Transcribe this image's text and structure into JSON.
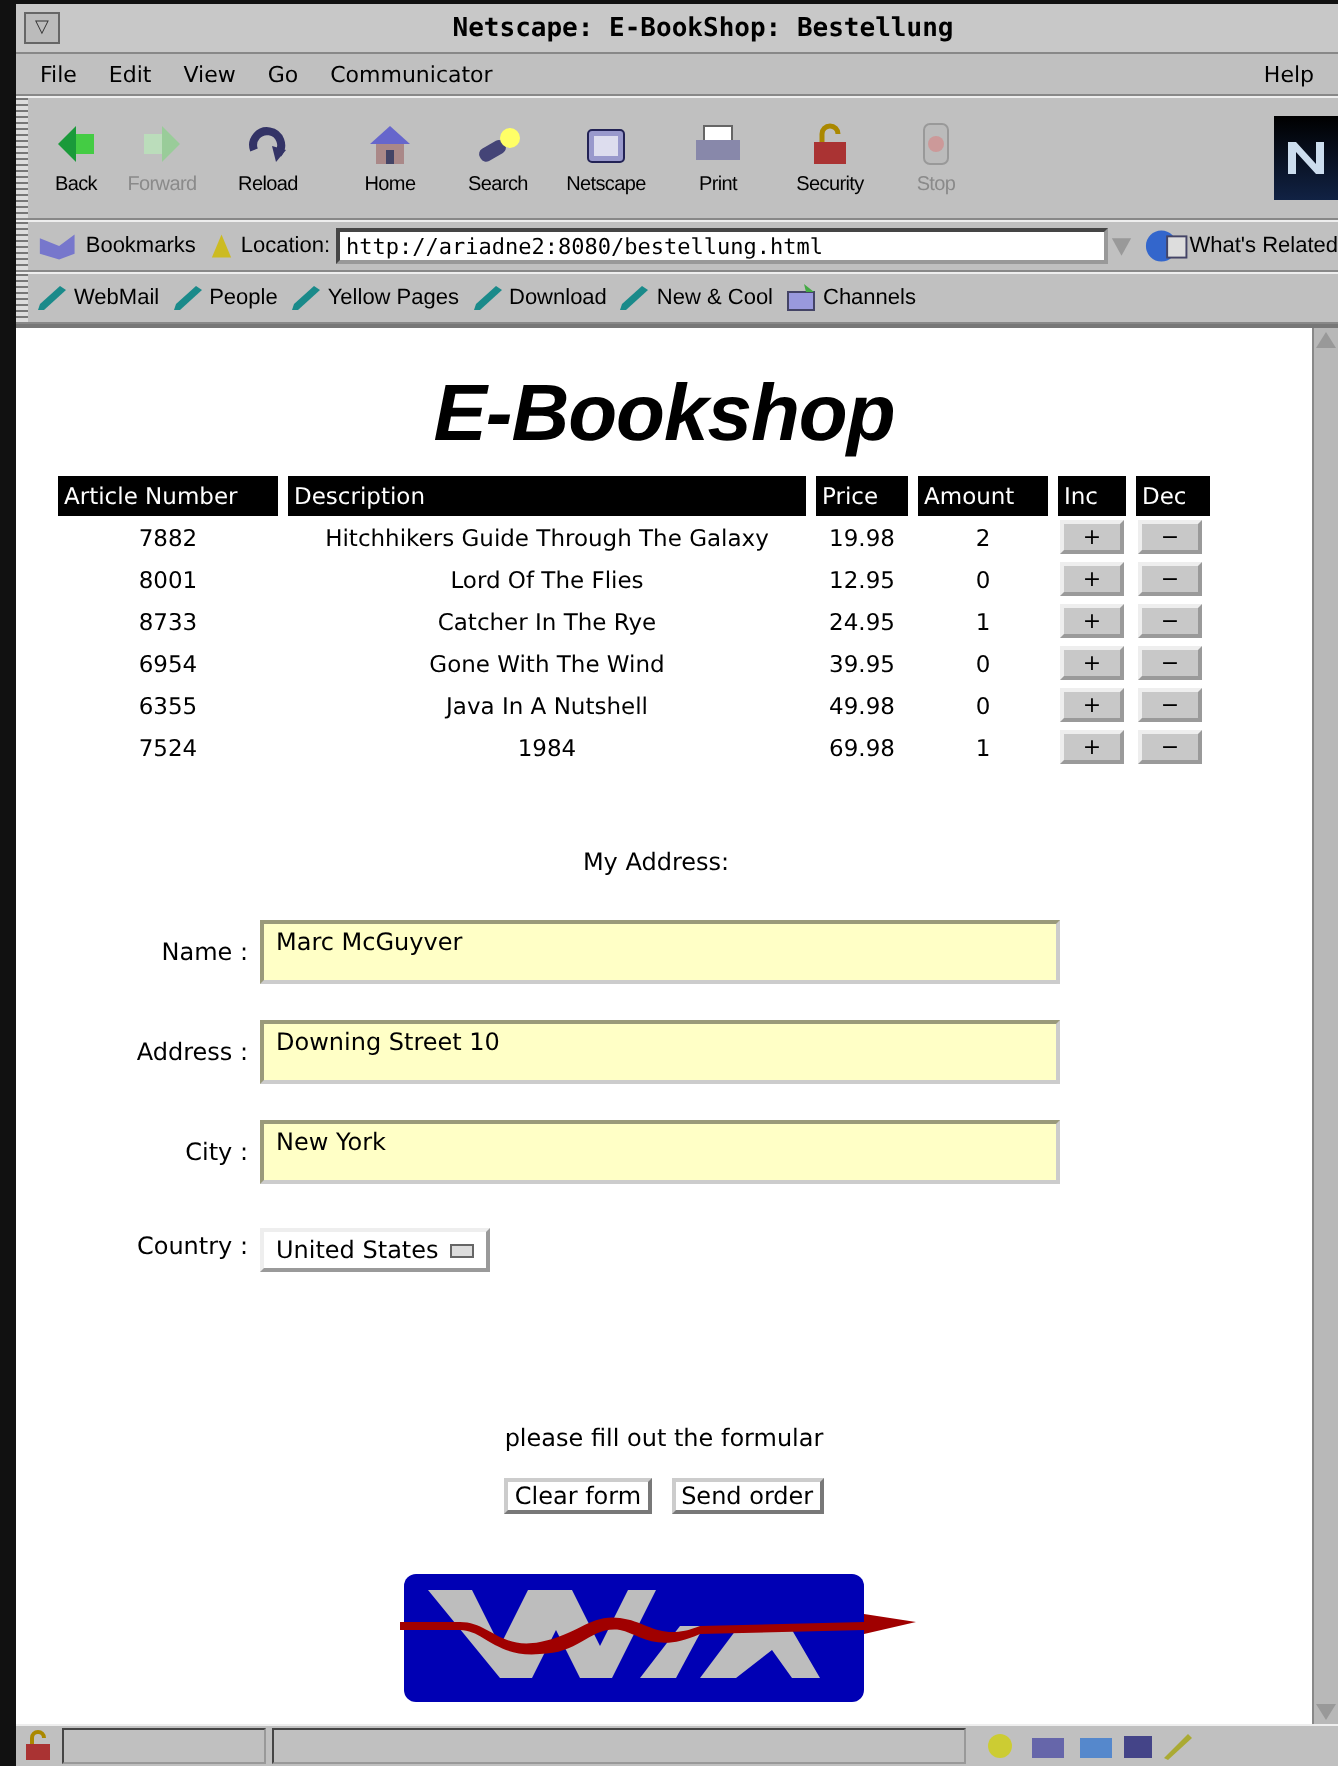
{
  "window": {
    "title": "Netscape: E-BookShop: Bestellung",
    "menu_button": "▽"
  },
  "menu": [
    "File",
    "Edit",
    "View",
    "Go",
    "Communicator",
    "Help"
  ],
  "toolbar": [
    {
      "label": "Back",
      "kind": "back",
      "disabled": false
    },
    {
      "label": "Forward",
      "kind": "forward",
      "disabled": true
    },
    {
      "label": "Reload",
      "kind": "reload",
      "disabled": false
    },
    {
      "label": "Home",
      "kind": "home",
      "disabled": false
    },
    {
      "label": "Search",
      "kind": "search",
      "disabled": false
    },
    {
      "label": "Netscape",
      "kind": "netscape",
      "disabled": false
    },
    {
      "label": "Print",
      "kind": "print",
      "disabled": false
    },
    {
      "label": "Security",
      "kind": "security",
      "disabled": false
    },
    {
      "label": "Stop",
      "kind": "stop",
      "disabled": true
    }
  ],
  "location_bar": {
    "bookmarks": "Bookmarks",
    "location_label": "Location:",
    "url": "http://ariadne2:8080/bestellung.html",
    "related": "What's Related"
  },
  "personal_toolbar": [
    {
      "label": "WebMail",
      "kind": "link"
    },
    {
      "label": "People",
      "kind": "link"
    },
    {
      "label": "Yellow Pages",
      "kind": "link"
    },
    {
      "label": "Download",
      "kind": "link"
    },
    {
      "label": "New & Cool",
      "kind": "link"
    },
    {
      "label": "Channels",
      "kind": "channels"
    }
  ],
  "page": {
    "heading": "E-Bookshop",
    "table": {
      "columns": [
        "Article Number",
        "Description",
        "Price",
        "Amount",
        "Inc",
        "Dec"
      ],
      "rows": [
        {
          "article_number": "7882",
          "description": "Hitchhikers Guide Through The Galaxy",
          "price": "19.98",
          "amount": "2",
          "inc": "+",
          "dec": "−"
        },
        {
          "article_number": "8001",
          "description": "Lord Of The Flies",
          "price": "12.95",
          "amount": "0",
          "inc": "+",
          "dec": "−"
        },
        {
          "article_number": "8733",
          "description": "Catcher In The Rye",
          "price": "24.95",
          "amount": "1",
          "inc": "+",
          "dec": "−"
        },
        {
          "article_number": "6954",
          "description": "Gone With The Wind",
          "price": "39.95",
          "amount": "0",
          "inc": "+",
          "dec": "−"
        },
        {
          "article_number": "6355",
          "description": "Java In A Nutshell",
          "price": "49.98",
          "amount": "0",
          "inc": "+",
          "dec": "−"
        },
        {
          "article_number": "7524",
          "description": "1984",
          "price": "69.98",
          "amount": "1",
          "inc": "+",
          "dec": "−"
        }
      ]
    },
    "address_heading": "My Address:",
    "fields": [
      {
        "label": "Name :",
        "value": "Marc McGuyver"
      },
      {
        "label": "Address :",
        "value": "Downing Street 10"
      },
      {
        "label": "City :",
        "value": "New York"
      }
    ],
    "country": {
      "label": "Country :",
      "value": "United States"
    },
    "note": "please fill out the formular",
    "buttons": [
      "Clear form",
      "Send order"
    ]
  }
}
